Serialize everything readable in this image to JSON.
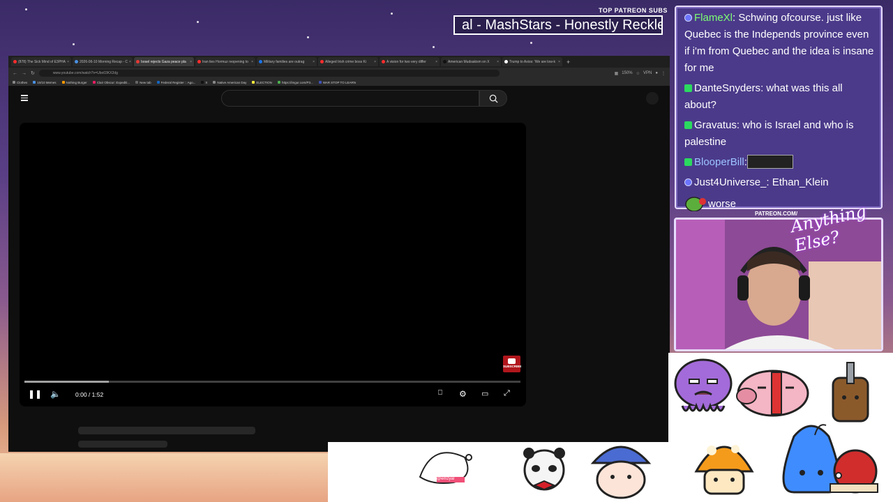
{
  "overlay": {
    "patreon_label": "TOP PATREON SUBS",
    "patreon_scroll": "al - MashStars - Honestly Reckles",
    "cam_label": "PATREON.COM/",
    "cam_script": "Anything Else?"
  },
  "browser": {
    "tabs": [
      {
        "label": "(878) The Sick Mind of E3PHA",
        "color": "#ff2d2d",
        "active": false
      },
      {
        "label": "2026-06-10 Morning Recap - C",
        "color": "#4a90e2",
        "active": false
      },
      {
        "label": "Israel rejects Gaza peace pla",
        "color": "#e53935",
        "active": true
      },
      {
        "label": "Iran ties Hormuz reopening to",
        "color": "#ff2d2d",
        "active": false
      },
      {
        "label": "Military families are outrag",
        "color": "#1a73e8",
        "active": false
      },
      {
        "label": "Alleged Irish crime boss Ki",
        "color": "#ff2d2d",
        "active": false
      },
      {
        "label": "A vision for two very differ",
        "color": "#ff2d2d",
        "active": false
      },
      {
        "label": "American Mudsakism on X",
        "color": "#111111",
        "active": false
      },
      {
        "label": "Trump to Axios: 'We are low-k",
        "color": "#ffffff",
        "active": false
      }
    ],
    "new_tab": "+",
    "url": "www.youtube.com/watch?v=Ubo03KX2dg",
    "zoom": "150%",
    "vpn": "VPN",
    "bookmarks": [
      {
        "label": "Clothes",
        "color": "#888888"
      },
      {
        "label": "10/10 Memes",
        "color": "#4a90e2"
      },
      {
        "label": "Nothing Burger",
        "color": "#ff9800"
      },
      {
        "label": "Clair Obscur: Expediti...",
        "color": "#e91e63"
      },
      {
        "label": "New tab",
        "color": "#666666"
      },
      {
        "label": "Federal Register :: Ago...",
        "color": "#1565c0"
      },
      {
        "label": "X",
        "color": "#111111"
      },
      {
        "label": "Native American Day",
        "color": "#888888"
      },
      {
        "label": "ELECTION",
        "color": "#ffeb3b"
      },
      {
        "label": "https://imgur.com/P3...",
        "color": "#4caf50"
      },
      {
        "label": "WAR STOP TO LEARN",
        "color": "#3f51b5"
      }
    ]
  },
  "youtube": {
    "time": "0:00 / 1:52",
    "subscribe_watermark": "SUBSCRIBE",
    "progress_buffered": 0.17
  },
  "chat": {
    "messages": [
      {
        "badge": "prime",
        "user": "FlameXl",
        "user_color": "flame",
        "text": ": Schwing ofcourse. just like Quebec is the Independs province even if i'm from Quebec and the idea is insane for me"
      },
      {
        "badge": "kick",
        "user": "DanteSnyders",
        "user_color": "white",
        "text": ": what was this all about?"
      },
      {
        "badge": "kick",
        "user": "Gravatus",
        "user_color": "white",
        "text": ": who is Israel and who is palestine"
      },
      {
        "badge": "kick",
        "user": "BlooperBill",
        "user_color": "blue",
        "text": ":"
      },
      {
        "badge": "prime",
        "user": "Just4Universe_",
        "user_color": "white",
        "text": ": Ethan_Klein"
      },
      {
        "badge": "none",
        "user": "",
        "user_color": "white",
        "text": "worse"
      }
    ]
  },
  "emotes": {
    "sticker_label": "@emzyal"
  }
}
